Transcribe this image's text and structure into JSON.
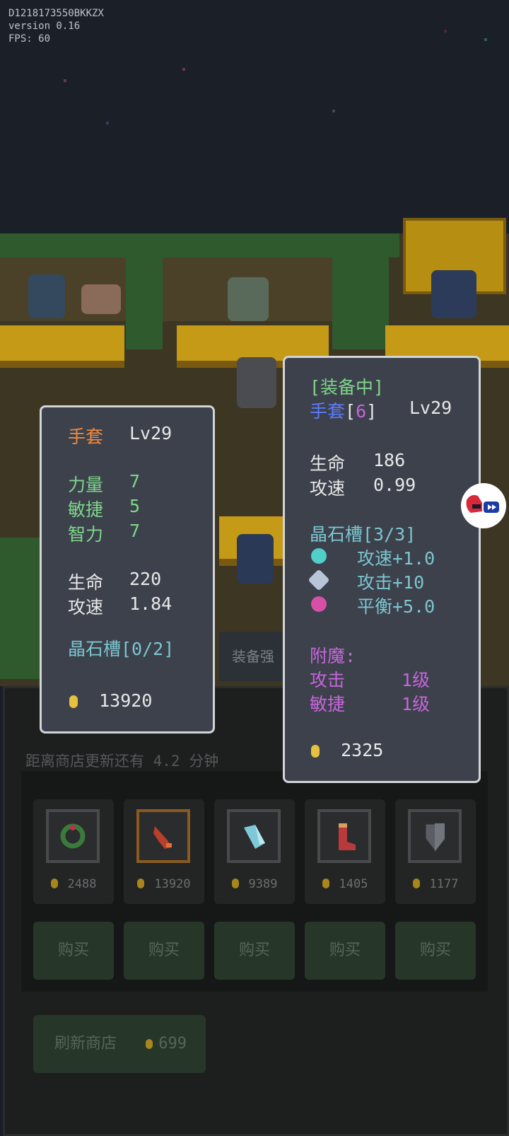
{
  "debug": {
    "device_id": "D1218173550BKKZX",
    "version": "version 0.16",
    "fps": "FPS: 60"
  },
  "left_panel": {
    "title": "手套",
    "level": "Lv29",
    "stats": [
      {
        "label": "力量",
        "value": "7"
      },
      {
        "label": "敏捷",
        "value": "5"
      },
      {
        "label": "智力",
        "value": "7"
      }
    ],
    "stats2": [
      {
        "label": "生命",
        "value": "220"
      },
      {
        "label": "攻速",
        "value": "1.84"
      }
    ],
    "slots": "晶石槽[0/2]",
    "price": "13920"
  },
  "right_panel": {
    "equipped": "[装备中]",
    "title": "手套",
    "bracket_open": "[",
    "enhance": "6",
    "bracket_close": "]",
    "level": "Lv29",
    "stats": [
      {
        "label": "生命",
        "value": "186"
      },
      {
        "label": "攻速",
        "value": "0.99"
      }
    ],
    "slots": "晶石槽[3/3]",
    "gems": [
      {
        "icon": "cyan-gem-icon",
        "text": "攻速+1.0"
      },
      {
        "icon": "silver-gem-icon",
        "text": "攻击+10"
      },
      {
        "icon": "pink-gem-icon",
        "text": "平衡+5.0"
      }
    ],
    "enchant_title": "附魔:",
    "enchants": [
      {
        "label": "攻击",
        "value": "1级"
      },
      {
        "label": "敏捷",
        "value": "1级"
      }
    ],
    "price": "2325"
  },
  "shop": {
    "enhance_tab": "装备强",
    "timer": "距离商店更新还有 4.2 分钟",
    "items": [
      {
        "icon": "ring-icon",
        "price": "2488"
      },
      {
        "icon": "glove-icon",
        "price": "13920",
        "selected": true
      },
      {
        "icon": "crystal-icon",
        "price": "9389"
      },
      {
        "icon": "boots-icon",
        "price": "1405"
      },
      {
        "icon": "shield-icon",
        "price": "1177"
      }
    ],
    "buy_label": "购买",
    "refresh_label": "刷新商店",
    "refresh_price": "699"
  },
  "colors": {
    "orange_title": "#f08a3c",
    "blue_title": "#5b7cff",
    "green": "#7fd68a",
    "teal": "#7cc6cf",
    "purple": "#c467d8",
    "white": "#e8e8e8"
  }
}
